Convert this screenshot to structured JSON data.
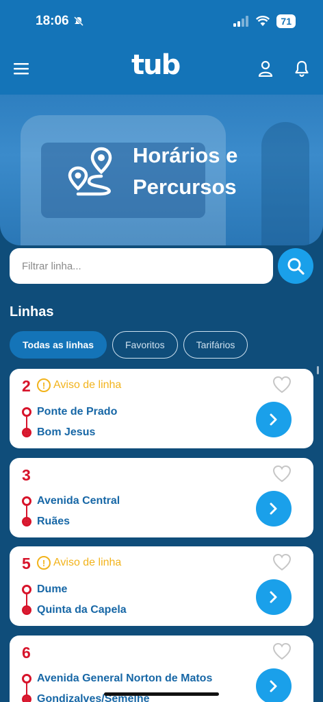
{
  "status": {
    "time": "18:06",
    "battery": "71"
  },
  "header": {
    "logo": "tub"
  },
  "hero": {
    "title": "Horários e Percursos"
  },
  "search": {
    "placeholder": "Filtrar linha..."
  },
  "section": {
    "title": "Linhas"
  },
  "filters": [
    "Todas as linhas",
    "Favoritos",
    "Tarifários"
  ],
  "lines": [
    {
      "number": "2",
      "warning": "Aviso de linha",
      "from": "Ponte de Prado",
      "to": "Bom Jesus"
    },
    {
      "number": "3",
      "warning": "",
      "from": "Avenida Central",
      "to": "Ruães"
    },
    {
      "number": "5",
      "warning": "Aviso de linha",
      "from": "Dume",
      "to": "Quinta da Capela"
    },
    {
      "number": "6",
      "warning": "",
      "from": "Avenida General Norton de Matos",
      "to": "Gondizalves/Semelhe"
    }
  ],
  "colors": {
    "primary": "#1474b8",
    "accent": "#1aa0ea",
    "line_red": "#d7132a",
    "warning": "#f2b31b"
  }
}
